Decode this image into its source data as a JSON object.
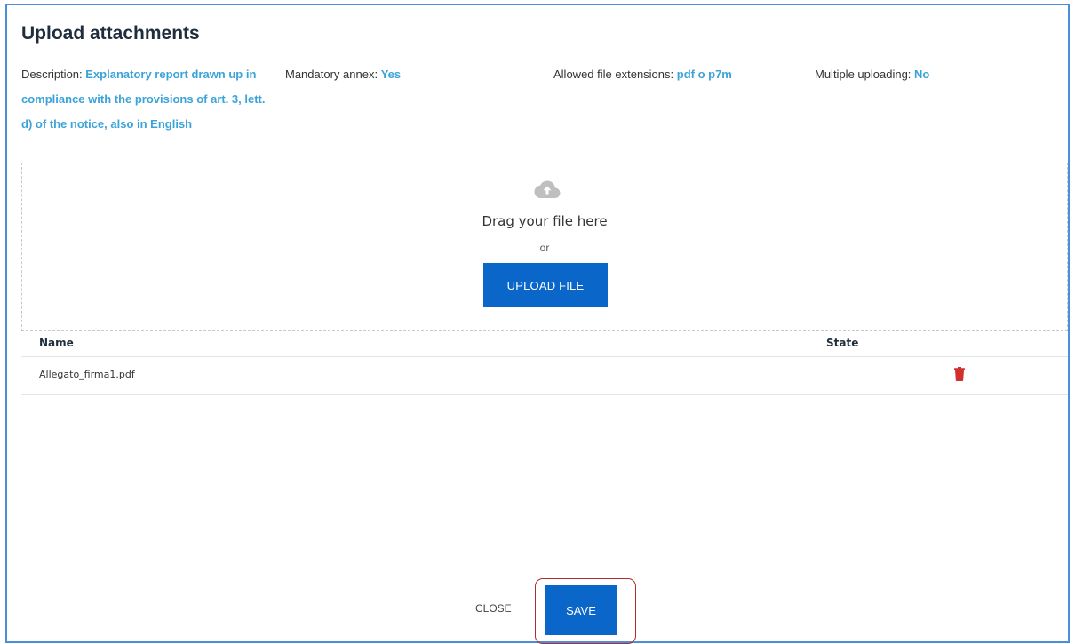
{
  "dialog": {
    "title": "Upload attachments"
  },
  "meta": {
    "description_label": "Description:",
    "description_value": "Explanatory report drawn up in compliance with the provisions of art. 3, lett. d) of the notice, also in English",
    "mandatory_label": "Mandatory annex:",
    "mandatory_value": "Yes",
    "extensions_label": "Allowed file extensions:",
    "extensions_value": "pdf o p7m",
    "multiple_label": "Multiple uploading:",
    "multiple_value": "No"
  },
  "dropzone": {
    "icon": "cloud-upload-icon",
    "drag_text": "Drag your file here",
    "or_text": "or",
    "upload_label": "UPLOAD FILE"
  },
  "table": {
    "headers": [
      "Name",
      "State"
    ],
    "rows": [
      {
        "name": "Allegato_firma1.pdf",
        "state": "",
        "action_icon": "trash-icon"
      }
    ]
  },
  "footer": {
    "close_label": "CLOSE",
    "save_label": "SAVE"
  },
  "colors": {
    "accent": "#3ba3d9",
    "primary_button": "#0a66c8",
    "delete_icon": "#d32f2f",
    "highlight_outline": "#b22b2b",
    "dialog_border": "#4a8fd8"
  }
}
